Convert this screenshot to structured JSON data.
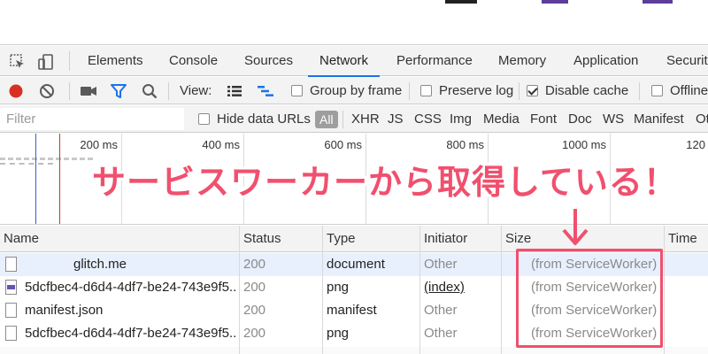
{
  "colors": {
    "record_red": "#d93025",
    "active_blue": "#1a73e8",
    "annotation_pink": "#f0506e",
    "selected_row": "#e8f0fe",
    "page_mark_dark": "#222222",
    "page_mark_purple": "#5c3d99"
  },
  "tabs": [
    {
      "label": "Elements"
    },
    {
      "label": "Console"
    },
    {
      "label": "Sources"
    },
    {
      "label": "Network",
      "active": true
    },
    {
      "label": "Performance"
    },
    {
      "label": "Memory"
    },
    {
      "label": "Application"
    },
    {
      "label": "Securit"
    }
  ],
  "tab_tools": {
    "inspect_icon": "inspect-element-icon",
    "device_icon": "device-toolbar-icon"
  },
  "toolbar": {
    "record_icon": "record-icon",
    "clear_icon": "clear-icon",
    "camera_icon": "camera-icon",
    "filter_icon": "filter-icon",
    "search_icon": "search-icon",
    "view_label": "View:",
    "list_view_icon": "list-view-icon",
    "waterfall_view_icon": "waterfall-view-icon",
    "group_by_frame": {
      "label": "Group by frame",
      "checked": false
    },
    "preserve_log": {
      "label": "Preserve log",
      "checked": false
    },
    "disable_cache": {
      "label": "Disable cache",
      "checked": true
    },
    "offline": {
      "label": "Offline",
      "checked": false
    }
  },
  "filterbar": {
    "filter_placeholder": "Filter",
    "hide_data_urls": {
      "label": "Hide data URLs",
      "checked": false
    },
    "types": [
      "All",
      "XHR",
      "JS",
      "CSS",
      "Img",
      "Media",
      "Font",
      "Doc",
      "WS",
      "Manifest",
      "Ot"
    ]
  },
  "timeline": {
    "ticks": [
      "200 ms",
      "400 ms",
      "600 ms",
      "800 ms",
      "1000 ms",
      "120"
    ]
  },
  "annotation": {
    "text": "サービスワーカーから取得している！",
    "arrow_icon": "down-arrow-icon"
  },
  "table": {
    "columns": [
      "Name",
      "Status",
      "Type",
      "Initiator",
      "Size",
      "Time"
    ],
    "rows": [
      {
        "name": "glitch.me",
        "status": "200",
        "type": "document",
        "initiator": "Other",
        "size": "(from ServiceWorker)",
        "icon": "document-file-icon"
      },
      {
        "name": "5dcfbec4-d6d4-4df7-be24-743e9f5...",
        "status": "200",
        "type": "png",
        "initiator": "(index)",
        "size": "(from ServiceWorker)",
        "icon": "png-file-icon"
      },
      {
        "name": "manifest.json",
        "status": "200",
        "type": "manifest",
        "initiator": "Other",
        "size": "(from ServiceWorker)",
        "icon": "manifest-file-icon"
      },
      {
        "name": "5dcfbec4-d6d4-4df7-be24-743e9f5...",
        "status": "200",
        "type": "png",
        "initiator": "Other",
        "size": "(from ServiceWorker)",
        "icon": "png-file-icon"
      }
    ]
  }
}
